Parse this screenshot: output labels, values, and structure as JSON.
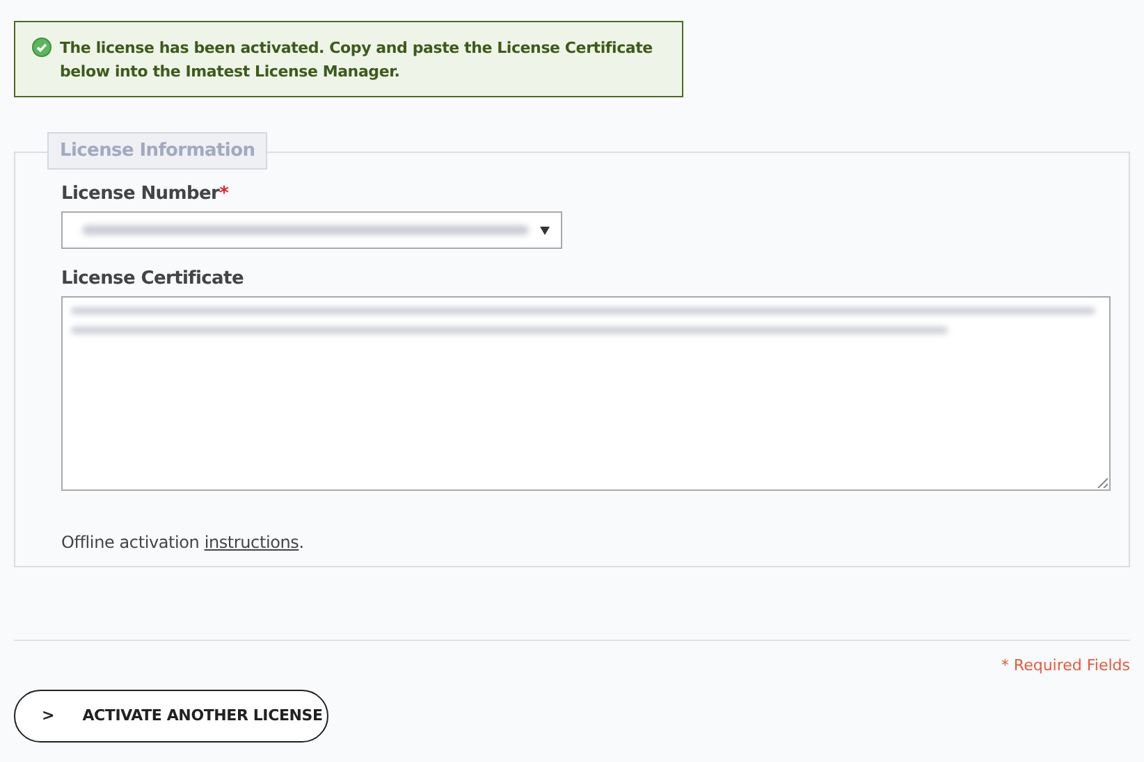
{
  "alert": {
    "kind": "success",
    "message": "The license has been activated. Copy and paste the License Certificate below into the Imatest License Manager."
  },
  "fieldset": {
    "legend": "License Information",
    "fields": [
      {
        "kind": "select",
        "label": "License Number",
        "required_mark": "*"
      },
      {
        "kind": "textarea",
        "label": "License Certificate"
      }
    ],
    "note": {
      "before": "Offline activation ",
      "link": "instructions",
      "after": "."
    }
  },
  "required_note": "* Required Fields",
  "button": {
    "icon_char": ">",
    "label": "ACTIVATE ANOTHER LICENSE"
  }
}
